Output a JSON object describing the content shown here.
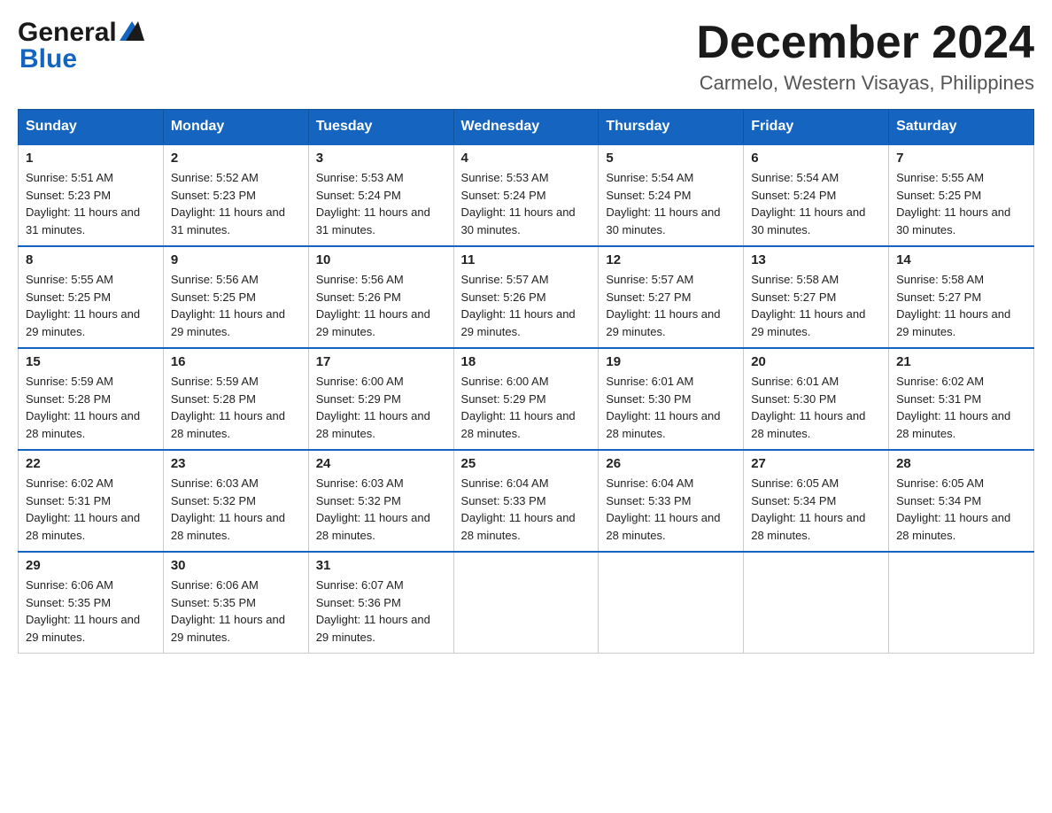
{
  "header": {
    "logo_top": "General",
    "logo_bottom": "Blue",
    "month_year": "December 2024",
    "location": "Carmelo, Western Visayas, Philippines"
  },
  "columns": [
    "Sunday",
    "Monday",
    "Tuesday",
    "Wednesday",
    "Thursday",
    "Friday",
    "Saturday"
  ],
  "weeks": [
    [
      {
        "day": "1",
        "sunrise": "5:51 AM",
        "sunset": "5:23 PM",
        "daylight": "11 hours and 31 minutes."
      },
      {
        "day": "2",
        "sunrise": "5:52 AM",
        "sunset": "5:23 PM",
        "daylight": "11 hours and 31 minutes."
      },
      {
        "day": "3",
        "sunrise": "5:53 AM",
        "sunset": "5:24 PM",
        "daylight": "11 hours and 31 minutes."
      },
      {
        "day": "4",
        "sunrise": "5:53 AM",
        "sunset": "5:24 PM",
        "daylight": "11 hours and 30 minutes."
      },
      {
        "day": "5",
        "sunrise": "5:54 AM",
        "sunset": "5:24 PM",
        "daylight": "11 hours and 30 minutes."
      },
      {
        "day": "6",
        "sunrise": "5:54 AM",
        "sunset": "5:24 PM",
        "daylight": "11 hours and 30 minutes."
      },
      {
        "day": "7",
        "sunrise": "5:55 AM",
        "sunset": "5:25 PM",
        "daylight": "11 hours and 30 minutes."
      }
    ],
    [
      {
        "day": "8",
        "sunrise": "5:55 AM",
        "sunset": "5:25 PM",
        "daylight": "11 hours and 29 minutes."
      },
      {
        "day": "9",
        "sunrise": "5:56 AM",
        "sunset": "5:25 PM",
        "daylight": "11 hours and 29 minutes."
      },
      {
        "day": "10",
        "sunrise": "5:56 AM",
        "sunset": "5:26 PM",
        "daylight": "11 hours and 29 minutes."
      },
      {
        "day": "11",
        "sunrise": "5:57 AM",
        "sunset": "5:26 PM",
        "daylight": "11 hours and 29 minutes."
      },
      {
        "day": "12",
        "sunrise": "5:57 AM",
        "sunset": "5:27 PM",
        "daylight": "11 hours and 29 minutes."
      },
      {
        "day": "13",
        "sunrise": "5:58 AM",
        "sunset": "5:27 PM",
        "daylight": "11 hours and 29 minutes."
      },
      {
        "day": "14",
        "sunrise": "5:58 AM",
        "sunset": "5:27 PM",
        "daylight": "11 hours and 29 minutes."
      }
    ],
    [
      {
        "day": "15",
        "sunrise": "5:59 AM",
        "sunset": "5:28 PM",
        "daylight": "11 hours and 28 minutes."
      },
      {
        "day": "16",
        "sunrise": "5:59 AM",
        "sunset": "5:28 PM",
        "daylight": "11 hours and 28 minutes."
      },
      {
        "day": "17",
        "sunrise": "6:00 AM",
        "sunset": "5:29 PM",
        "daylight": "11 hours and 28 minutes."
      },
      {
        "day": "18",
        "sunrise": "6:00 AM",
        "sunset": "5:29 PM",
        "daylight": "11 hours and 28 minutes."
      },
      {
        "day": "19",
        "sunrise": "6:01 AM",
        "sunset": "5:30 PM",
        "daylight": "11 hours and 28 minutes."
      },
      {
        "day": "20",
        "sunrise": "6:01 AM",
        "sunset": "5:30 PM",
        "daylight": "11 hours and 28 minutes."
      },
      {
        "day": "21",
        "sunrise": "6:02 AM",
        "sunset": "5:31 PM",
        "daylight": "11 hours and 28 minutes."
      }
    ],
    [
      {
        "day": "22",
        "sunrise": "6:02 AM",
        "sunset": "5:31 PM",
        "daylight": "11 hours and 28 minutes."
      },
      {
        "day": "23",
        "sunrise": "6:03 AM",
        "sunset": "5:32 PM",
        "daylight": "11 hours and 28 minutes."
      },
      {
        "day": "24",
        "sunrise": "6:03 AM",
        "sunset": "5:32 PM",
        "daylight": "11 hours and 28 minutes."
      },
      {
        "day": "25",
        "sunrise": "6:04 AM",
        "sunset": "5:33 PM",
        "daylight": "11 hours and 28 minutes."
      },
      {
        "day": "26",
        "sunrise": "6:04 AM",
        "sunset": "5:33 PM",
        "daylight": "11 hours and 28 minutes."
      },
      {
        "day": "27",
        "sunrise": "6:05 AM",
        "sunset": "5:34 PM",
        "daylight": "11 hours and 28 minutes."
      },
      {
        "day": "28",
        "sunrise": "6:05 AM",
        "sunset": "5:34 PM",
        "daylight": "11 hours and 28 minutes."
      }
    ],
    [
      {
        "day": "29",
        "sunrise": "6:06 AM",
        "sunset": "5:35 PM",
        "daylight": "11 hours and 29 minutes."
      },
      {
        "day": "30",
        "sunrise": "6:06 AM",
        "sunset": "5:35 PM",
        "daylight": "11 hours and 29 minutes."
      },
      {
        "day": "31",
        "sunrise": "6:07 AM",
        "sunset": "5:36 PM",
        "daylight": "11 hours and 29 minutes."
      },
      null,
      null,
      null,
      null
    ]
  ],
  "labels": {
    "sunrise": "Sunrise:",
    "sunset": "Sunset:",
    "daylight": "Daylight:"
  }
}
